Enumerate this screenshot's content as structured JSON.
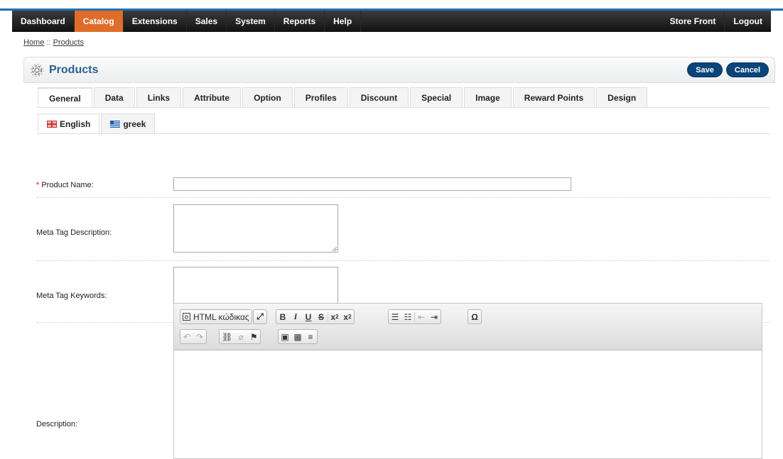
{
  "menu": {
    "left": [
      "Dashboard",
      "Catalog",
      "Extensions",
      "Sales",
      "System",
      "Reports",
      "Help"
    ],
    "right": [
      "Store Front",
      "Logout"
    ],
    "active": "Catalog"
  },
  "breadcrumb": {
    "home": "Home",
    "separator": " :: ",
    "current": "Products"
  },
  "page": {
    "title": "Products",
    "save": "Save",
    "cancel": "Cancel"
  },
  "tabs": [
    "General",
    "Data",
    "Links",
    "Attribute",
    "Option",
    "Profiles",
    "Discount",
    "Special",
    "Image",
    "Reward Points",
    "Design"
  ],
  "active_tab": "General",
  "languages": [
    "English",
    "greek"
  ],
  "active_language": "English",
  "form": {
    "product_name_required": "*",
    "product_name_label": " Product Name:",
    "meta_description_label": "Meta Tag Description:",
    "meta_keywords_label": "Meta Tag Keywords:",
    "description_label": "Description:"
  },
  "editor": {
    "html_label": "HTML κώδικας",
    "icons": [
      "source-icon",
      "fullscreen-icon",
      "bold-icon",
      "italic-icon",
      "underline-icon",
      "strikethrough-icon",
      "subscript-icon",
      "superscript-icon",
      "numbered-list-icon",
      "bulleted-list-icon",
      "outdent-icon",
      "indent-icon",
      "special-char-icon",
      "undo-icon",
      "redo-icon",
      "link-icon",
      "unlink-icon",
      "anchor-icon",
      "image-icon",
      "table-icon",
      "horizontal-line-icon"
    ]
  },
  "colors": {
    "accent": "#e06c2a",
    "button": "#0a447a",
    "title": "#2d5f8b",
    "topline": "#1f6fb1"
  }
}
